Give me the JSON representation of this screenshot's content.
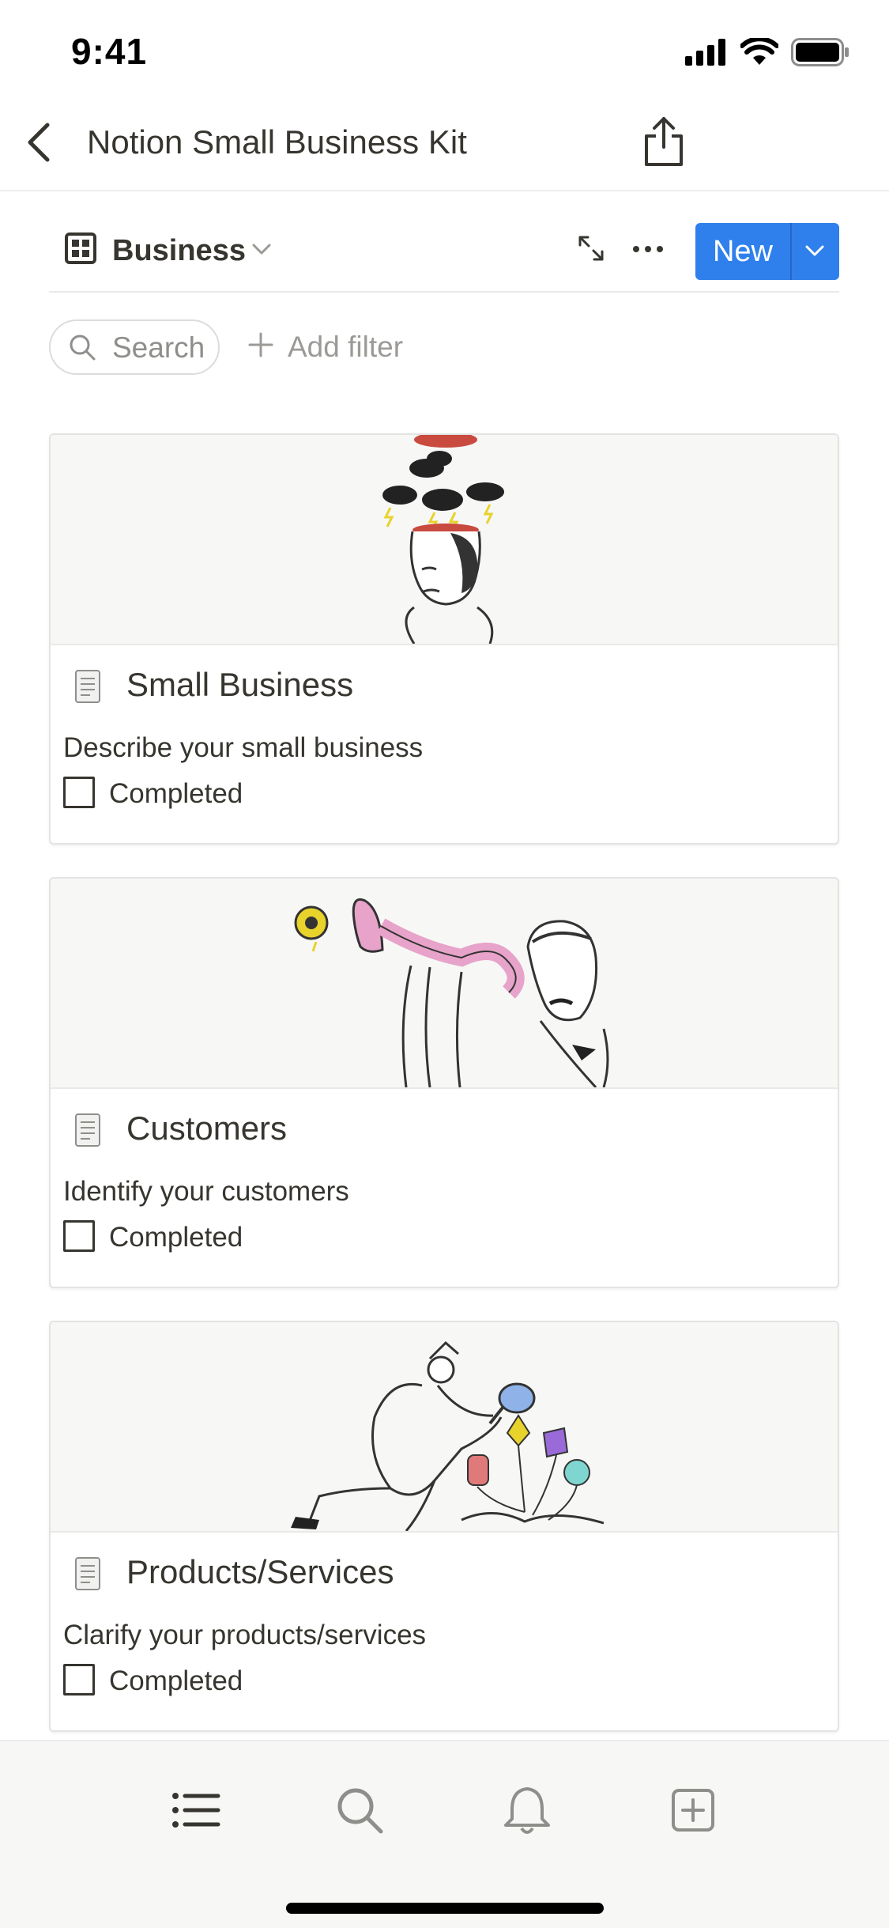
{
  "status_bar": {
    "time": "9:41"
  },
  "nav": {
    "title": "Notion Small Business Kit"
  },
  "toolbar": {
    "view_name": "Business",
    "new_label": "New"
  },
  "filters": {
    "search_label": "Search",
    "add_filter_label": "Add filter"
  },
  "cards": [
    {
      "title": "Small Business",
      "description": "Describe your small business",
      "checkbox_label": "Completed",
      "checked": false
    },
    {
      "title": "Customers",
      "description": "Identify your customers",
      "checkbox_label": "Completed",
      "checked": false
    },
    {
      "title": "Products/Services",
      "description": "Clarify your products/services",
      "checkbox_label": "Completed",
      "checked": false
    }
  ],
  "tabbar": {
    "tabs": [
      "list-icon",
      "search-icon",
      "bell-icon",
      "new-page-icon"
    ]
  },
  "colors": {
    "accent": "#2f80ed",
    "text": "#37352f",
    "muted": "#9b9a97",
    "cover_bg": "#f7f7f6"
  }
}
